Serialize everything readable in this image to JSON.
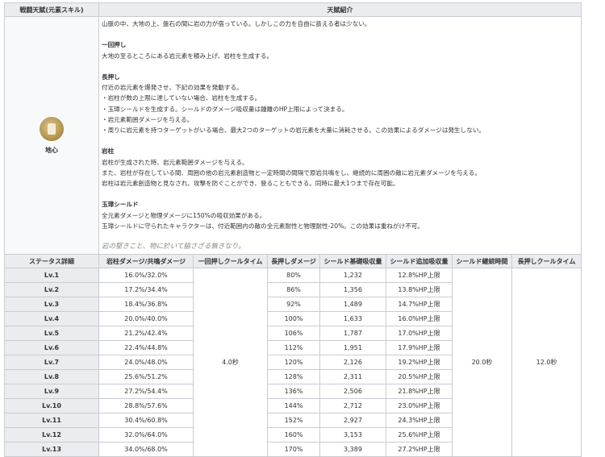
{
  "header": {
    "col1": "戦闘天賦(元素スキル)",
    "col2": "天賦紹介"
  },
  "skill": {
    "name": "地心",
    "desc_lines": [
      {
        "t": "山脈の中、大地の上、盤石の間に岩の力が宿っている。しかしこの力を自由に扱える者は少ない。",
        "k": "text"
      },
      {
        "t": "",
        "k": "gap"
      },
      {
        "t": "一回押し",
        "k": "hd"
      },
      {
        "t": "大地の至るところにある岩元素を積み上げ、岩柱を生成する。",
        "k": "text"
      },
      {
        "t": "",
        "k": "gap"
      },
      {
        "t": "長押し",
        "k": "hd"
      },
      {
        "t": "付近の岩元素を爆発させ、下記の効果を発動する。",
        "k": "text"
      },
      {
        "t": "・岩柱が数の上限に達していない場合、岩柱を生成する。",
        "k": "text"
      },
      {
        "t": "・玉璋シールドを生成する。シールドのダメージ吸収量は鍾離のHP上限によって決まる。",
        "k": "text"
      },
      {
        "t": "・岩元素範囲ダメージを与える。",
        "k": "text"
      },
      {
        "t": "・周りに岩元素を持つターゲットがいる場合、最大2つのターゲットの岩元素を大量に消耗させる。この効果によるダメージは発生しない。",
        "k": "text"
      },
      {
        "t": "",
        "k": "gap"
      },
      {
        "t": "岩柱",
        "k": "hd"
      },
      {
        "t": "岩柱が生成された時、岩元素範囲ダメージを与える。",
        "k": "text"
      },
      {
        "t": "また、岩柱が存在している間、周囲の他の岩元素創造物と一定時間の間隔で原岩共鳴をし、継続的に周囲の敵に岩元素ダメージを与える。",
        "k": "text"
      },
      {
        "t": "岩柱は岩元素創造物と見なされ、攻撃を防ぐことができ、登ることもできる。同時に最大1つまで存在可能。",
        "k": "text"
      },
      {
        "t": "",
        "k": "gap"
      },
      {
        "t": "玉璋シールド",
        "k": "hd"
      },
      {
        "t": "全元素ダメージと物理ダメージに150%の吸収効果がある。",
        "k": "text"
      },
      {
        "t": "玉璋シールドに守られたキャラクターは、付近範囲内の敵の全元素耐性と物理耐性-20%。この効果は重ねがけ不可。",
        "k": "text"
      },
      {
        "t": "",
        "k": "gap"
      },
      {
        "t": "岩の堅きこと、物に於いて脇さざる無きなり。",
        "k": "quote"
      }
    ]
  },
  "stats": {
    "headers": [
      "ステータス詳細",
      "岩柱ダメージ/共鳴ダメージ",
      "一回押しクールタイム",
      "長押しダメージ",
      "シールド基礎吸収量",
      "シールド追加吸収量",
      "シールド継続時間",
      "長押しクールタイム"
    ],
    "tap_cd": "4.0秒",
    "shield_duration": "20.0秒",
    "hold_cd": "12.0秒",
    "rows": [
      {
        "lv": "Lv.1",
        "pillar": "16.0%/32.0%",
        "hold": "80%",
        "base": "1,232",
        "add": "12.8%HP上限"
      },
      {
        "lv": "Lv.2",
        "pillar": "17.2%/34.4%",
        "hold": "86%",
        "base": "1,356",
        "add": "13.8%HP上限"
      },
      {
        "lv": "Lv.3",
        "pillar": "18.4%/36.8%",
        "hold": "92%",
        "base": "1,489",
        "add": "14.7%HP上限"
      },
      {
        "lv": "Lv.4",
        "pillar": "20.0%/40.0%",
        "hold": "100%",
        "base": "1,633",
        "add": "16.0%HP上限"
      },
      {
        "lv": "Lv.5",
        "pillar": "21.2%/42.4%",
        "hold": "106%",
        "base": "1,787",
        "add": "17.0%HP上限"
      },
      {
        "lv": "Lv.6",
        "pillar": "22.4%/44.8%",
        "hold": "112%",
        "base": "1,951",
        "add": "17.9%HP上限"
      },
      {
        "lv": "Lv.7",
        "pillar": "24.0%/48.0%",
        "hold": "120%",
        "base": "2,126",
        "add": "19.2%HP上限"
      },
      {
        "lv": "Lv.8",
        "pillar": "25.6%/51.2%",
        "hold": "128%",
        "base": "2,311",
        "add": "20.5%HP上限"
      },
      {
        "lv": "Lv.9",
        "pillar": "27.2%/54.4%",
        "hold": "136%",
        "base": "2,506",
        "add": "21.8%HP上限"
      },
      {
        "lv": "Lv.10",
        "pillar": "28.8%/57.6%",
        "hold": "144%",
        "base": "2,712",
        "add": "23.0%HP上限"
      },
      {
        "lv": "Lv.11",
        "pillar": "30.4%/60.8%",
        "hold": "152%",
        "base": "2,927",
        "add": "24.3%HP上限"
      },
      {
        "lv": "Lv.12",
        "pillar": "32.0%/64.0%",
        "hold": "160%",
        "base": "3,153",
        "add": "25.6%HP上限"
      },
      {
        "lv": "Lv.13",
        "pillar": "34.0%/68.0%",
        "hold": "170%",
        "base": "3,389",
        "add": "27.2%HP上限"
      }
    ]
  }
}
